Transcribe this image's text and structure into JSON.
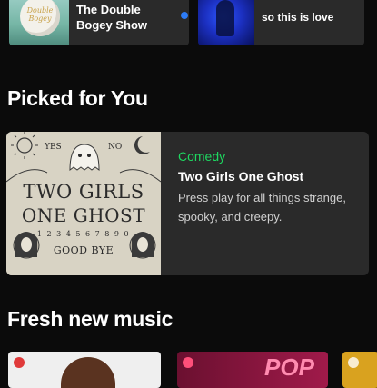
{
  "shortcuts": [
    {
      "title": "The Double Bogey Show",
      "art_label": "Double Bogey",
      "has_new_episode": true,
      "new_dot_color": "#2d7cf6"
    },
    {
      "title": "so this is love"
    }
  ],
  "picked": {
    "heading": "Picked for You",
    "card": {
      "genre": "Comedy",
      "title": "Two Girls One Ghost",
      "description": "Press play for all things strange, spooky, and creepy.",
      "cover": {
        "line1": "TWO GIRLS",
        "line2": "ONE GHOST",
        "yes": "YES",
        "no": "NO",
        "numbers": "1 2 3 4 5 6 7 8 9 0",
        "goodbye": "GOOD BYE"
      }
    }
  },
  "fresh": {
    "heading": "Fresh new music",
    "cards": [
      {
        "art_label": ""
      },
      {
        "art_label": "POP"
      },
      {
        "art_label": ""
      }
    ]
  },
  "colors": {
    "background": "#0b0b0b",
    "card": "#2a2a2a",
    "accent_green": "#1ed760"
  }
}
